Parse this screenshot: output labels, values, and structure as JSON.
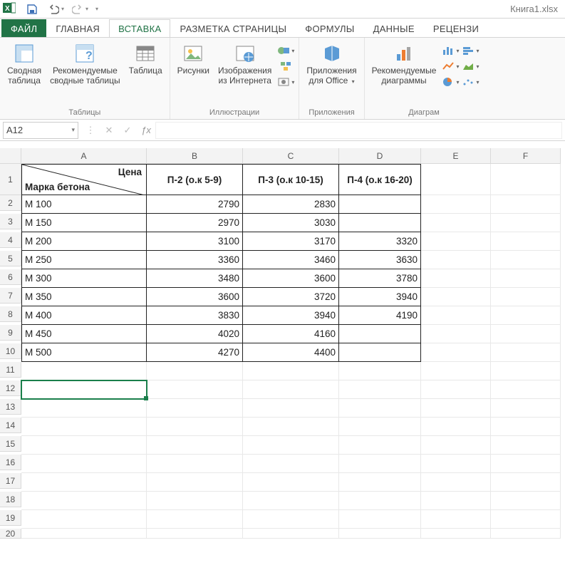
{
  "qat": {
    "title": "Книга1.xlsx"
  },
  "tabs": {
    "file": "ФАЙЛ",
    "home": "ГЛАВНАЯ",
    "insert": "ВСТАВКА",
    "pagelayout": "РАЗМЕТКА СТРАНИЦЫ",
    "formulas": "ФОРМУЛЫ",
    "data": "ДАННЫЕ",
    "review": "РЕЦЕНЗИ"
  },
  "ribbon": {
    "tables": {
      "pivot": "Сводная\nтаблица",
      "recommended_pivot": "Рекомендуемые\nсводные таблицы",
      "table": "Таблица",
      "group": "Таблицы"
    },
    "illustrations": {
      "pictures": "Рисунки",
      "online_pictures": "Изображения\nиз Интернета",
      "group": "Иллюстрации"
    },
    "apps": {
      "apps": "Приложения\nдля Office",
      "group": "Приложения"
    },
    "charts": {
      "recommended": "Рекомендуемые\nдиаграммы",
      "group": "Диаграм"
    }
  },
  "namebox": "A12",
  "columns": [
    "A",
    "B",
    "C",
    "D",
    "E",
    "F"
  ],
  "rows": [
    "1",
    "2",
    "3",
    "4",
    "5",
    "6",
    "7",
    "8",
    "9",
    "10",
    "11",
    "12",
    "13",
    "14",
    "15",
    "16",
    "17",
    "18",
    "19",
    "20"
  ],
  "table": {
    "header_diag_top": "Цена",
    "header_diag_bottom": "Марка бетона",
    "headers": [
      "П-2 (о.к 5-9)",
      "П-3 (о.к 10-15)",
      "П-4 (о.к 16-20)"
    ],
    "rows": [
      {
        "label": "М 100",
        "v": [
          "2790",
          "2830",
          ""
        ]
      },
      {
        "label": "М 150",
        "v": [
          "2970",
          "3030",
          ""
        ]
      },
      {
        "label": "М 200",
        "v": [
          "3100",
          "3170",
          "3320"
        ]
      },
      {
        "label": "М 250",
        "v": [
          "3360",
          "3460",
          "3630"
        ]
      },
      {
        "label": "М 300",
        "v": [
          "3480",
          "3600",
          "3780"
        ]
      },
      {
        "label": "М 350",
        "v": [
          "3600",
          "3720",
          "3940"
        ]
      },
      {
        "label": "М 400",
        "v": [
          "3830",
          "3940",
          "4190"
        ]
      },
      {
        "label": "М 450",
        "v": [
          "4020",
          "4160",
          ""
        ]
      },
      {
        "label": "М 500",
        "v": [
          "4270",
          "4400",
          ""
        ]
      }
    ]
  }
}
